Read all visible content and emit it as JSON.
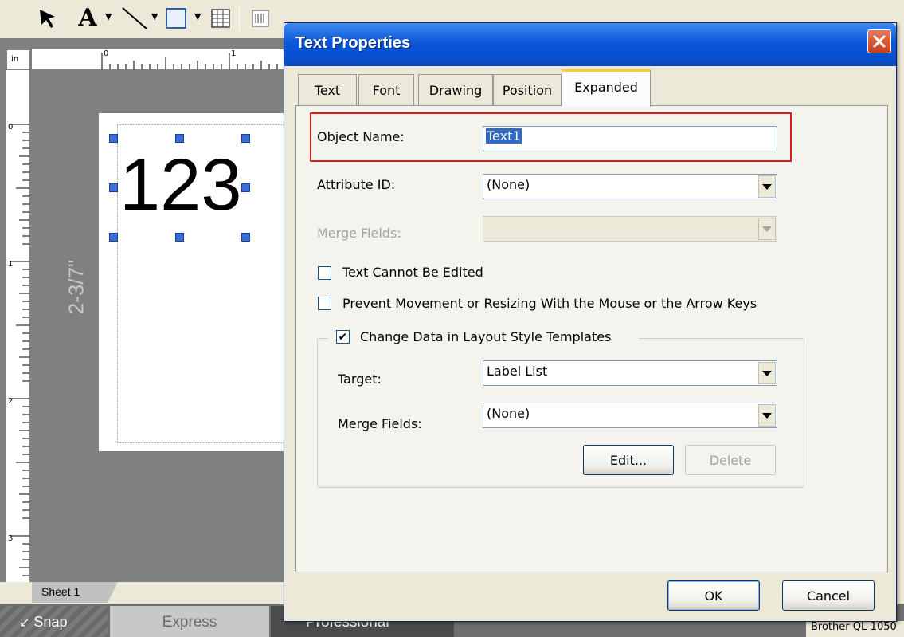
{
  "editor": {
    "unit": "in",
    "ruler_h_numbers": [
      "0",
      "1"
    ],
    "ruler_v_numbers": [
      "0",
      "1",
      "2",
      "3"
    ],
    "label_size": "2-3/7\"",
    "object_text": "123",
    "sheet_tab": "Sheet 1",
    "mode_tabs": {
      "snap": "Snap",
      "express": "Express",
      "professional": "Professional"
    },
    "status_text": "Brother QL-1050"
  },
  "dialog": {
    "title": "Text Properties",
    "tabs": [
      {
        "label": "Text"
      },
      {
        "label": "Font"
      },
      {
        "label": "Drawing"
      },
      {
        "label": "Position"
      },
      {
        "label": "Expanded",
        "active": true
      }
    ],
    "object_name": {
      "label": "Object Name:",
      "value": "Text1"
    },
    "attribute_id": {
      "label": "Attribute ID:",
      "value": "(None)"
    },
    "merge_fields_top": {
      "label": "Merge Fields:",
      "value": "",
      "disabled": true
    },
    "text_cannot_be_edited": {
      "label": "Text Cannot Be Edited",
      "checked": false
    },
    "prevent_movement": {
      "label": "Prevent Movement or Resizing With the Mouse or the Arrow Keys",
      "checked": false
    },
    "change_data_group": {
      "label": "Change Data in Layout Style Templates",
      "checked": true,
      "target": {
        "label": "Target:",
        "value": "Label List"
      },
      "merge_fields": {
        "label": "Merge Fields:",
        "value": "(None)"
      },
      "edit_button": "Edit...",
      "delete_button": "Delete"
    },
    "ok_button": "OK",
    "cancel_button": "Cancel"
  },
  "colors": {
    "highlight_border": "#e01818",
    "titlebar": "#0a56d8",
    "selection": "#316ac5"
  }
}
